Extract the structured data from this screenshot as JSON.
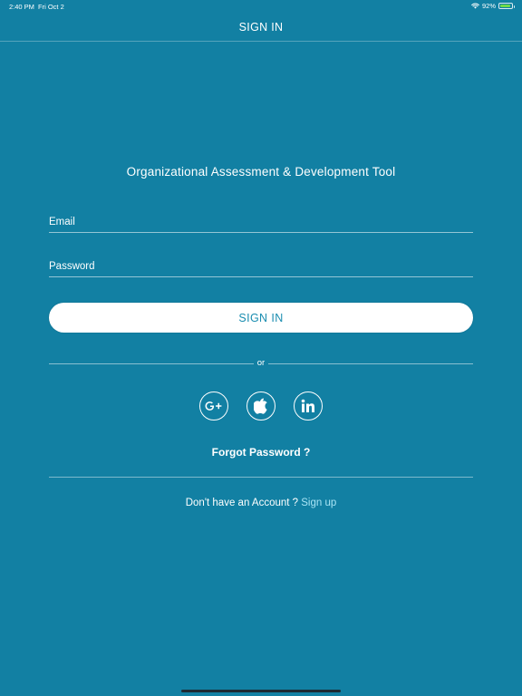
{
  "status_bar": {
    "time": "2:40 PM",
    "date": "Fri Oct 2",
    "battery": "92%",
    "battery_level": 0.92
  },
  "nav": {
    "title": "SIGN IN"
  },
  "app": {
    "title": "Organizational Assessment & Development Tool"
  },
  "form": {
    "email_placeholder": "Email",
    "email_value": "",
    "password_placeholder": "Password",
    "password_value": "",
    "signin_label": "SIGN IN",
    "divider_text": "or"
  },
  "social": [
    {
      "name": "google-plus-icon",
      "label": "G+"
    },
    {
      "name": "apple-icon"
    },
    {
      "name": "linkedin-icon",
      "label": "in"
    }
  ],
  "links": {
    "forgot_password": "Forgot Password ?",
    "no_account": "Don't have an Account ?",
    "signup": "Sign up"
  },
  "colors": {
    "background": "#1280a3",
    "button_text": "#1a8db0",
    "link_accent": "#a8e4f5"
  }
}
